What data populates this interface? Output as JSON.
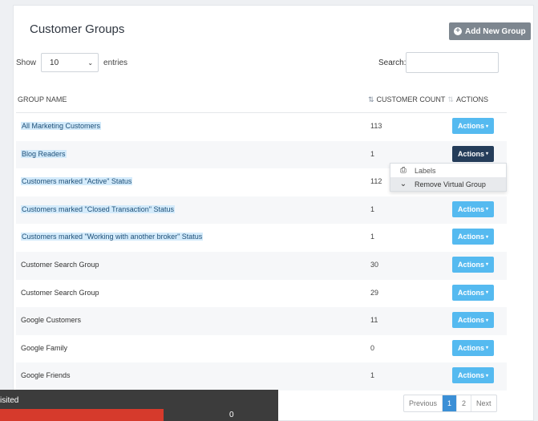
{
  "header": {
    "title": "Customer Groups",
    "add_label": "Add New Group"
  },
  "controls": {
    "show_label": "Show",
    "entries_value": "10",
    "entries_label": "entries",
    "search_label": "Search:",
    "search_value": ""
  },
  "table": {
    "columns": [
      "GROUP NAME",
      "CUSTOMER COUNT",
      "ACTIONS"
    ],
    "rows": [
      {
        "name": "All Marketing Customers",
        "count": "113",
        "action": "Actions",
        "highlight": true
      },
      {
        "name": "Blog Readers",
        "count": "1",
        "action": "Actions",
        "highlight": true
      },
      {
        "name": "Customers marked \"Active\" Status",
        "count": "112",
        "action": "Actions",
        "highlight": true
      },
      {
        "name": "Customers marked \"Closed Transaction\" Status",
        "count": "1",
        "action": "Actions",
        "highlight": true
      },
      {
        "name": "Customers marked \"Working with another broker\" Status",
        "count": "1",
        "action": "Actions",
        "highlight": true
      },
      {
        "name": "Customer Search Group",
        "count": "30",
        "action": "Actions",
        "highlight": false
      },
      {
        "name": "Customer Search Group",
        "count": "29",
        "action": "Actions",
        "highlight": false
      },
      {
        "name": "Google Customers",
        "count": "11",
        "action": "Actions",
        "highlight": false
      },
      {
        "name": "Google Family",
        "count": "0",
        "action": "Actions",
        "highlight": false
      },
      {
        "name": "Google Friends",
        "count": "1",
        "action": "Actions",
        "highlight": false
      }
    ]
  },
  "dropdown": {
    "items": [
      {
        "label": "Labels",
        "icon": "printer-icon"
      },
      {
        "label": "Remove Virtual Group",
        "icon": "chevron-down-icon"
      }
    ]
  },
  "pagination": {
    "previous": "Previous",
    "pages": [
      "1",
      "2"
    ],
    "next": "Next"
  },
  "overlay": {
    "label": "isited",
    "value": "0"
  },
  "colors": {
    "action_button": "#55baf0",
    "action_button_active": "#253d5a",
    "highlight": "#d4ebfb",
    "overlay_bar": "#d63a2c"
  }
}
